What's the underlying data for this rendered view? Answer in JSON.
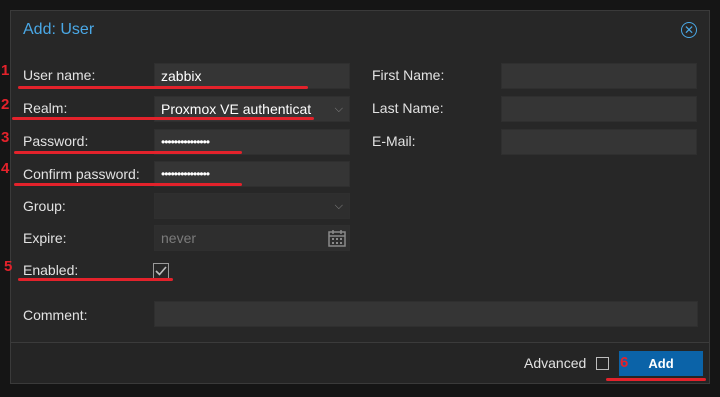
{
  "dialog": {
    "title": "Add: User",
    "close_icon": "close-circle-icon"
  },
  "form": {
    "user_name_label": "User name:",
    "user_name_value": "zabbix",
    "realm_label": "Realm:",
    "realm_value": "Proxmox VE authenticat",
    "password_label": "Password:",
    "password_value": "•••••••••••••••",
    "confirm_password_label": "Confirm password:",
    "confirm_password_value": "•••••••••••••••",
    "group_label": "Group:",
    "group_value": "",
    "expire_label": "Expire:",
    "expire_placeholder": "never",
    "enabled_label": "Enabled:",
    "enabled_checked": true,
    "comment_label": "Comment:",
    "comment_value": "",
    "first_name_label": "First Name:",
    "first_name_value": "",
    "last_name_label": "Last Name:",
    "last_name_value": "",
    "email_label": "E-Mail:",
    "email_value": ""
  },
  "footer": {
    "advanced_label": "Advanced",
    "advanced_checked": false,
    "add_label": "Add"
  },
  "annotations": [
    "1",
    "2",
    "3",
    "4",
    "5",
    "6"
  ],
  "colors": {
    "accent": "#4aa8e6",
    "primary_button": "#0b63a8",
    "annotation": "#e3222b",
    "background": "#272727"
  }
}
